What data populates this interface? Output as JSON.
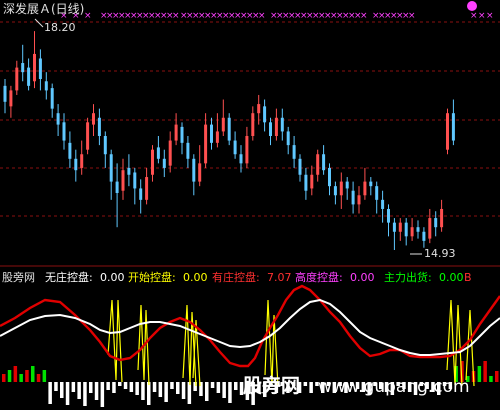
{
  "upper_panel": {
    "title": "深发展Ａ(日线)",
    "high_label": "18.20",
    "low_label": "14.93",
    "colors": {
      "up": "#ff5050",
      "down": "#60c8ff",
      "grid": "#8a1010",
      "markers": "#ff40ff",
      "text": "#e0e0e0"
    }
  },
  "lower_panel": {
    "label_site": "股旁网",
    "indicators": [
      {
        "name": "无庄控盘:",
        "value": "0.00",
        "color": "#ffffff"
      },
      {
        "name": "开始控盘:",
        "value": "0.00",
        "color": "#ffff00"
      },
      {
        "name": "有庄控盘:",
        "value": "7.07",
        "color": "#ff3030"
      },
      {
        "name": "高度控盘:",
        "value": "0.00",
        "color": "#ff40ff"
      },
      {
        "name": "主力出货:",
        "value": "0.00",
        "color": "#00ff00"
      }
    ],
    "trailing_marker": "B",
    "colors": {
      "white_line": "#ffffff",
      "red_line": "#e00000",
      "yellow": "#ffff00"
    }
  },
  "watermark": {
    "cn": "股旁网",
    "url": "www.gupang.com"
  },
  "chart_data": {
    "type": "candlestick",
    "high": 18.2,
    "low": 14.93,
    "candles_y": [
      [
        0.72,
        0.65,
        0.75,
        0.6
      ],
      [
        0.63,
        0.7,
        0.72,
        0.58
      ],
      [
        0.7,
        0.8,
        0.83,
        0.68
      ],
      [
        0.82,
        0.78,
        0.9,
        0.74
      ],
      [
        0.8,
        0.72,
        0.84,
        0.7
      ],
      [
        0.74,
        0.86,
        0.96,
        0.71
      ],
      [
        0.84,
        0.75,
        0.88,
        0.7
      ],
      [
        0.74,
        0.7,
        0.78,
        0.66
      ],
      [
        0.71,
        0.62,
        0.73,
        0.58
      ],
      [
        0.6,
        0.55,
        0.64,
        0.5
      ],
      [
        0.56,
        0.48,
        0.6,
        0.44
      ],
      [
        0.47,
        0.4,
        0.52,
        0.36
      ],
      [
        0.4,
        0.35,
        0.44,
        0.3
      ],
      [
        0.36,
        0.42,
        0.48,
        0.33
      ],
      [
        0.44,
        0.56,
        0.58,
        0.42
      ],
      [
        0.55,
        0.6,
        0.64,
        0.5
      ],
      [
        0.58,
        0.5,
        0.62,
        0.46
      ],
      [
        0.5,
        0.42,
        0.52,
        0.36
      ],
      [
        0.42,
        0.3,
        0.44,
        0.22
      ],
      [
        0.3,
        0.25,
        0.38,
        0.1
      ],
      [
        0.26,
        0.35,
        0.4,
        0.22
      ],
      [
        0.36,
        0.33,
        0.42,
        0.28
      ],
      [
        0.34,
        0.27,
        0.36,
        0.2
      ],
      [
        0.27,
        0.22,
        0.31,
        0.16
      ],
      [
        0.22,
        0.32,
        0.36,
        0.2
      ],
      [
        0.33,
        0.44,
        0.46,
        0.3
      ],
      [
        0.45,
        0.4,
        0.5,
        0.38
      ],
      [
        0.4,
        0.36,
        0.44,
        0.32
      ],
      [
        0.37,
        0.48,
        0.52,
        0.34
      ],
      [
        0.48,
        0.55,
        0.6,
        0.46
      ],
      [
        0.54,
        0.47,
        0.56,
        0.42
      ],
      [
        0.47,
        0.4,
        0.5,
        0.36
      ],
      [
        0.4,
        0.3,
        0.42,
        0.24
      ],
      [
        0.3,
        0.38,
        0.46,
        0.28
      ],
      [
        0.38,
        0.55,
        0.6,
        0.36
      ],
      [
        0.55,
        0.47,
        0.58,
        0.44
      ],
      [
        0.47,
        0.52,
        0.6,
        0.45
      ],
      [
        0.52,
        0.58,
        0.66,
        0.5
      ],
      [
        0.58,
        0.48,
        0.6,
        0.46
      ],
      [
        0.48,
        0.42,
        0.52,
        0.4
      ],
      [
        0.42,
        0.38,
        0.46,
        0.34
      ],
      [
        0.38,
        0.5,
        0.54,
        0.36
      ],
      [
        0.5,
        0.6,
        0.63,
        0.48
      ],
      [
        0.6,
        0.64,
        0.68,
        0.55
      ],
      [
        0.63,
        0.56,
        0.66,
        0.52
      ],
      [
        0.56,
        0.5,
        0.58,
        0.46
      ],
      [
        0.5,
        0.58,
        0.62,
        0.48
      ],
      [
        0.58,
        0.52,
        0.62,
        0.48
      ],
      [
        0.52,
        0.46,
        0.54,
        0.42
      ],
      [
        0.46,
        0.4,
        0.5,
        0.36
      ],
      [
        0.4,
        0.33,
        0.42,
        0.3
      ],
      [
        0.33,
        0.26,
        0.36,
        0.22
      ],
      [
        0.27,
        0.33,
        0.37,
        0.24
      ],
      [
        0.33,
        0.42,
        0.44,
        0.3
      ],
      [
        0.42,
        0.35,
        0.46,
        0.33
      ],
      [
        0.36,
        0.28,
        0.38,
        0.24
      ],
      [
        0.28,
        0.24,
        0.3,
        0.2
      ],
      [
        0.24,
        0.3,
        0.34,
        0.18
      ],
      [
        0.3,
        0.27,
        0.32,
        0.22
      ],
      [
        0.26,
        0.2,
        0.3,
        0.16
      ],
      [
        0.2,
        0.24,
        0.28,
        0.16
      ],
      [
        0.24,
        0.3,
        0.36,
        0.22
      ],
      [
        0.3,
        0.28,
        0.32,
        0.24
      ],
      [
        0.28,
        0.22,
        0.3,
        0.16
      ],
      [
        0.22,
        0.18,
        0.26,
        0.12
      ],
      [
        0.18,
        0.12,
        0.2,
        0.06
      ],
      [
        0.12,
        0.08,
        0.14,
        0.0
      ],
      [
        0.08,
        0.12,
        0.14,
        0.04
      ],
      [
        0.12,
        0.06,
        0.14,
        0.02
      ],
      [
        0.06,
        0.1,
        0.14,
        0.04
      ],
      [
        0.1,
        0.08,
        0.13,
        0.05
      ],
      [
        0.08,
        0.04,
        0.1,
        0.01
      ],
      [
        0.05,
        0.14,
        0.18,
        0.03
      ],
      [
        0.14,
        0.1,
        0.17,
        0.06
      ],
      [
        0.1,
        0.18,
        0.22,
        0.08
      ],
      [
        0.44,
        0.6,
        0.62,
        0.42
      ],
      [
        0.6,
        0.48,
        0.66,
        0.46
      ]
    ]
  }
}
